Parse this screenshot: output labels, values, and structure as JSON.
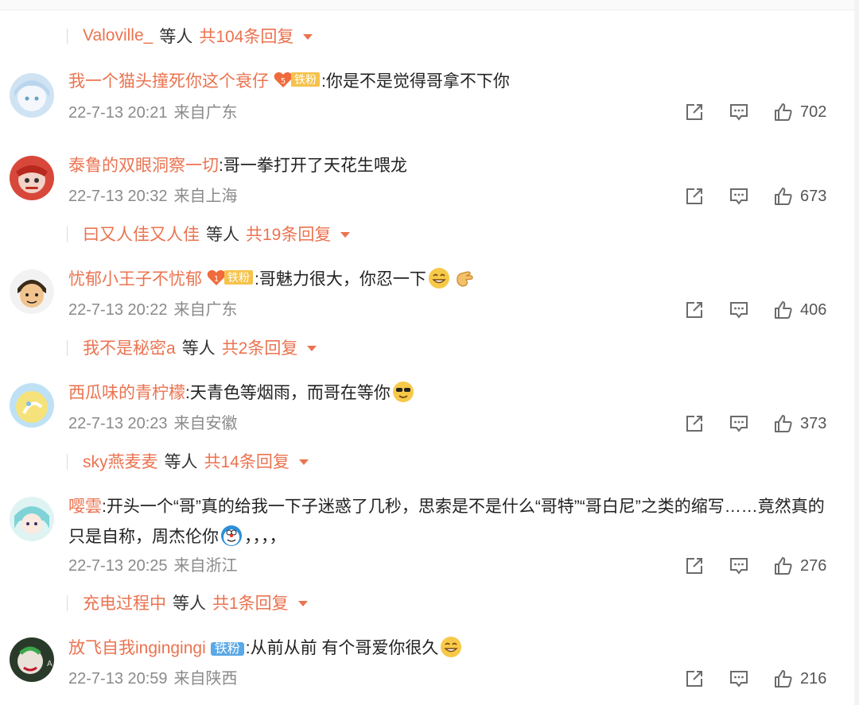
{
  "replies": [
    {
      "name": "Valoville_",
      "middle": "等人",
      "count": "共104条回复"
    },
    {
      "name": "曰又人佳又人佳",
      "middle": "等人",
      "count": "共19条回复"
    },
    {
      "name": "我不是秘密a",
      "middle": "等人",
      "count": "共2条回复"
    },
    {
      "name": "sky燕麦麦",
      "middle": "等人",
      "count": "共14条回复"
    },
    {
      "name": "充电过程中",
      "middle": "等人",
      "count": "共1条回复"
    }
  ],
  "comments": [
    {
      "user": "我一个猫头撞死你这个衰仔",
      "badge_text": "铁粉",
      "badge_level": "5",
      "text": ":你是不是觉得哥拿不下你",
      "time": "22-7-13 20:21",
      "loc": "来自广东",
      "likes": "702"
    },
    {
      "user": "泰鲁的双眼洞察一切",
      "text": ":哥一拳打开了天花生喂龙",
      "time": "22-7-13 20:32",
      "loc": "来自上海",
      "likes": "673"
    },
    {
      "user": "忧郁小王子不忧郁",
      "badge_text": "铁粉",
      "badge_level": "1",
      "text": ":哥魅力很大，你忍一下",
      "time": "22-7-13 20:22",
      "loc": "来自广东",
      "likes": "406"
    },
    {
      "user": "西瓜味的青柠檬",
      "text": ":天青色等烟雨，而哥在等你",
      "time": "22-7-13 20:23",
      "loc": "来自安徽",
      "likes": "373"
    },
    {
      "user": "嘤雲",
      "text": ":开头一个“哥”真的给我一下子迷惑了几秒，思索是不是什么“哥特”“哥白尼”之类的缩写……竟然真的只是自称，周杰伦你",
      "text_tail": "，，，，",
      "time": "22-7-13 20:25",
      "loc": "来自浙江",
      "likes": "276"
    },
    {
      "user": "放飞自我ingingingi",
      "badge_text": "铁粉",
      "text": ":从前从前 有个哥爱你很久",
      "time": "22-7-13 20:59",
      "loc": "来自陕西",
      "likes": "216"
    }
  ],
  "icons": {
    "share": "share-icon",
    "comment": "comment-icon",
    "like": "thumbs-up-icon",
    "caret": "caret-down-icon"
  },
  "colors": {
    "username": "#eb7350",
    "meta": "#8a8a8a",
    "badge_gold": "#f6c24b",
    "badge_blue": "#5aa8e6"
  }
}
